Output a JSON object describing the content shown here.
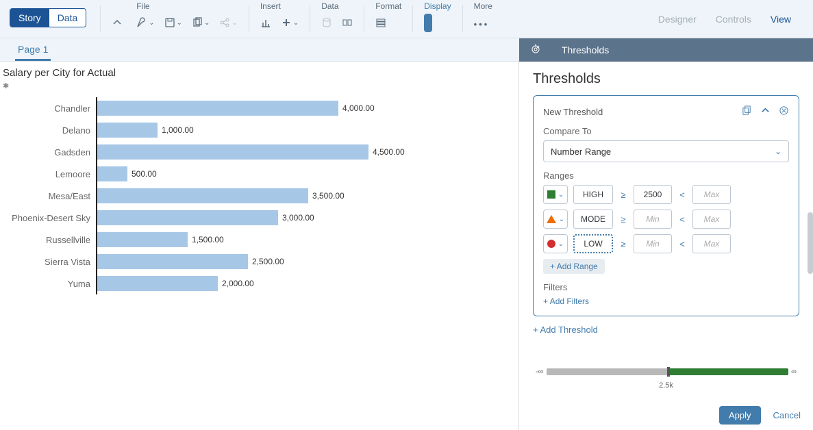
{
  "mode": {
    "story": "Story",
    "data": "Data"
  },
  "ribbon": {
    "file": "File",
    "insert": "Insert",
    "data": "Data",
    "format": "Format",
    "display": "Display",
    "more": "More"
  },
  "right_links": {
    "designer": "Designer",
    "controls": "Controls",
    "view": "View"
  },
  "page_tab": "Page 1",
  "chart": {
    "title": "Salary per City for Actual"
  },
  "chart_data": {
    "type": "bar",
    "orientation": "horizontal",
    "title": "Salary per City for Actual",
    "xlabel": "",
    "ylabel": "",
    "categories": [
      "Chandler",
      "Delano",
      "Gadsden",
      "Lemoore",
      "Mesa/East",
      "Phoenix-Desert Sky",
      "Russellville",
      "Sierra Vista",
      "Yuma"
    ],
    "values": [
      4000,
      1000,
      4500,
      500,
      3500,
      3000,
      1500,
      2500,
      2000
    ],
    "value_labels": [
      "4,000.00",
      "1,000.00",
      "4,500.00",
      "500.00",
      "3,500.00",
      "3,000.00",
      "1,500.00",
      "2,500.00",
      "2,000.00"
    ],
    "xlim": [
      0,
      5000
    ]
  },
  "panel": {
    "header_title": "Thresholds",
    "title": "Thresholds",
    "card": {
      "name": "New Threshold",
      "compare_label": "Compare To",
      "compare_value": "Number Range",
      "ranges_label": "Ranges",
      "ranges": [
        {
          "shape": "sq-green",
          "name": "HIGH",
          "name_focus": false,
          "min": "2500",
          "min_ph": false,
          "max": "Max",
          "max_ph": true
        },
        {
          "shape": "tri-orange",
          "name": "MODE",
          "name_focus": false,
          "min": "Min",
          "min_ph": true,
          "max": "Max",
          "max_ph": true
        },
        {
          "shape": "sq-red",
          "name": "LOW",
          "name_focus": true,
          "min": "Min",
          "min_ph": true,
          "max": "Max",
          "max_ph": true
        }
      ],
      "add_range": "Add Range",
      "filters_label": "Filters",
      "add_filters": "Add Filters"
    },
    "add_threshold": "Add Threshold",
    "slider_tick": "2.5k",
    "apply": "Apply",
    "cancel": "Cancel"
  }
}
